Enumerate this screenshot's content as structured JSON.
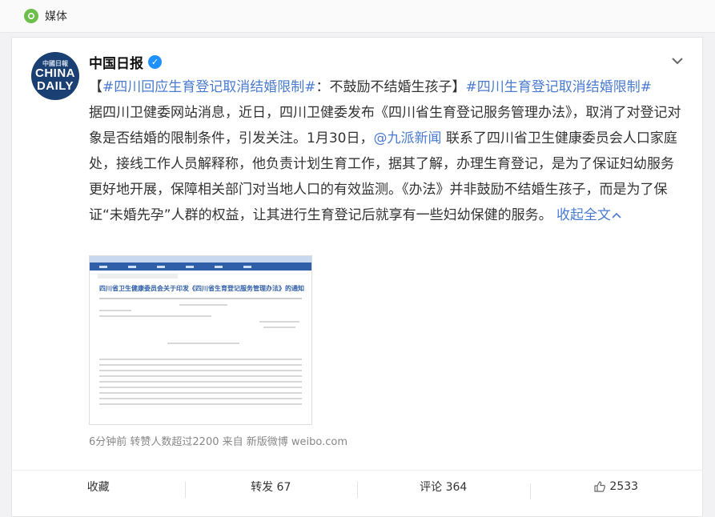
{
  "topbar": {
    "label": "媒体"
  },
  "post": {
    "avatar_top": "中國日報",
    "avatar_line1": "CHINA",
    "avatar_line2": "DAILY",
    "author": "中国日报",
    "headline_bracket_open": "【",
    "hashtag1": "#四川回应生育登记取消结婚限制#",
    "headline_rest": "：不鼓励不结婚生孩子】",
    "hashtag2": "#四川生育登记取消结婚限制#",
    "body_part1": "据四川卫健委网站消息，近日，四川卫健委发布《四川省生育登记服务管理办法》，取消了对登记对象是否结婚的限制条件，引发关注。1月30日，",
    "mention": "@九派新闻",
    "body_part2": " 联系了四川省卫生健康委员会人口家庭处，接线工作人员解释称，他负责计划生育工作，据其了解，办理生育登记，是为了保证妇幼服务更好地开展，保障相关部门对当地人口的有效监测。《办法》并非鼓励不结婚生孩子，而是为了保证“未婚先孕”人群的权益，让其进行生育登记后就享有一些妇幼保健的服务。 ",
    "collapse": "收起全文",
    "image_title": "四川省卫生健康委员会关于印发《四川省生育登记服务管理办法》的通知",
    "meta": "6分钟前 转赞人数超过2200  来自 新版微博 weibo.com"
  },
  "actions": {
    "favorite": "收藏",
    "repost": "转发 67",
    "comment": "评论 364",
    "like": "2533"
  },
  "colors": {
    "link": "#4a7bd0",
    "verified": "#1e90ff",
    "brand_green": "#6cc04a"
  }
}
